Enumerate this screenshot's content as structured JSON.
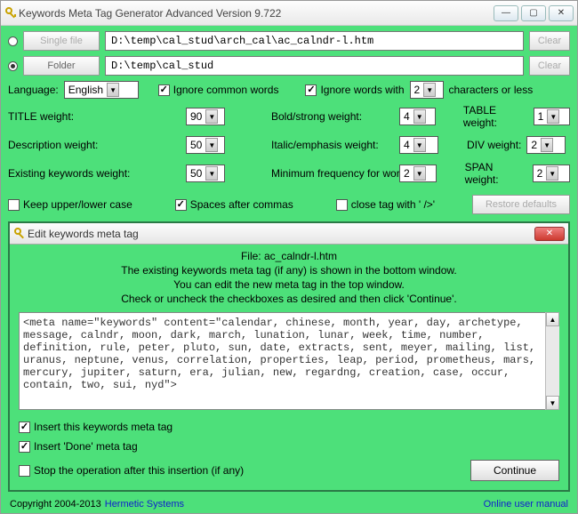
{
  "window": {
    "title": "Keywords Meta Tag Generator Advanced Version 9.722",
    "btn_min": "—",
    "btn_max": "▢",
    "btn_close": "✕"
  },
  "file_row": {
    "single_file_label": "Single file",
    "single_file_path": "D:\\temp\\cal_stud\\arch_cal\\ac_calndr-l.htm",
    "folder_label": "Folder",
    "folder_path": "D:\\temp\\cal_stud",
    "clear_label": "Clear"
  },
  "lang": {
    "label": "Language:",
    "value": "English",
    "ignore_common": "Ignore common words",
    "ignore_words_with": "Ignore words with",
    "chars_or_less": "characters or less",
    "chars_value": "2"
  },
  "weights": {
    "title_label": "TITLE weight:",
    "title_val": "90",
    "bold_label": "Bold/strong weight:",
    "bold_val": "4",
    "table_label": "TABLE weight:",
    "table_val": "1",
    "desc_label": "Description weight:",
    "desc_val": "50",
    "italic_label": "Italic/emphasis weight:",
    "italic_val": "4",
    "div_label": "DIV weight:",
    "div_val": "2",
    "existing_label": "Existing keywords weight:",
    "existing_val": "50",
    "minfreq_label": "Minimum frequency for word:",
    "minfreq_val": "2",
    "span_label": "SPAN weight:",
    "span_val": "2"
  },
  "opts": {
    "keep_case": "Keep upper/lower case",
    "spaces": "Spaces after commas",
    "close_tag": "close tag with ' />'",
    "restore": "Restore defaults"
  },
  "dialog": {
    "title": "Edit keywords meta tag",
    "file_line": "File: ac_calndr-l.htm",
    "line1": "The existing keywords meta tag (if any) is shown in the bottom window.",
    "line2": "You can edit the new meta tag in the top window.",
    "line3": "Check or uncheck the checkboxes as desired and then click 'Continue'.",
    "textarea": "<meta name=\"keywords\" content=\"calendar, chinese, month, year, day, archetype, message, calndr, moon, dark, march, lunation, lunar, week, time, number, definition, rule, peter, pluto, sun, date, extracts, sent, meyer, mailing, list, uranus, neptune, venus, correlation, properties, leap, period, prometheus, mars, mercury, jupiter, saturn, era, julian, new, regardng, creation, case, occur, contain, two, sui, nyd\">",
    "chk_insert": "Insert this keywords meta tag",
    "chk_done": "Insert 'Done' meta tag",
    "chk_stop": "Stop the operation after this insertion (if any)",
    "continue": "Continue"
  },
  "footer": {
    "copyright": "Copyright 2004-2013",
    "company": "Hermetic Systems",
    "manual": "Online user manual"
  }
}
